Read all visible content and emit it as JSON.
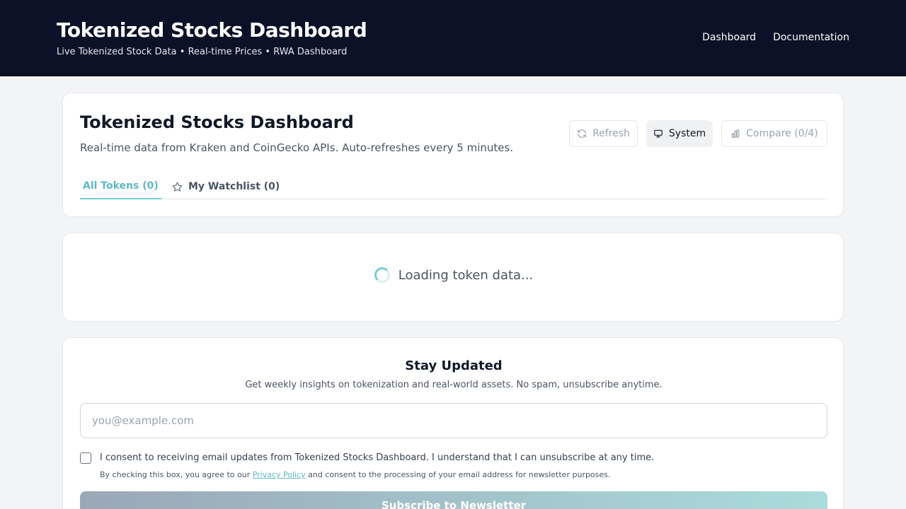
{
  "header": {
    "title": "Tokenized Stocks Dashboard",
    "subtitle": "Live Tokenized Stock Data • Real-time Prices • RWA Dashboard",
    "nav": [
      {
        "label": "Dashboard"
      },
      {
        "label": "Documentation"
      }
    ]
  },
  "dashboard": {
    "title": "Tokenized Stocks Dashboard",
    "description": "Real-time data from Kraken and CoinGecko APIs. Auto-refreshes every 5 minutes.",
    "buttons": {
      "refresh": {
        "label": "Refresh",
        "icon": "refresh-icon"
      },
      "system": {
        "label": "System",
        "icon": "monitor-icon"
      },
      "compare": {
        "label": "Compare (0/4)",
        "icon": "bar-chart-icon"
      }
    },
    "tabs": [
      {
        "label": "All Tokens (0)",
        "active": true
      },
      {
        "label": "My Watchlist (0)",
        "icon": "star-icon"
      }
    ]
  },
  "loading": {
    "text": "Loading token data..."
  },
  "newsletter": {
    "title": "Stay Updated",
    "description": "Get weekly insights on tokenization and real-world assets. No spam, unsubscribe anytime.",
    "email_placeholder": "you@example.com",
    "email_value": "",
    "consent_label": "I consent to receiving email updates from Tokenized Stocks Dashboard. I understand that I can unsubscribe at any time.",
    "consent_checked": false,
    "fine_print_before": "By checking this box, you agree to our ",
    "privacy_link": "Privacy Policy",
    "fine_print_after": " and consent to the processing of your email address for newsletter purposes.",
    "subscribe_label": "Subscribe to Newsletter"
  },
  "colors": {
    "header_bg": "#0b1126",
    "accent": "#5fb8c4",
    "page_bg": "#f3f4f6"
  }
}
